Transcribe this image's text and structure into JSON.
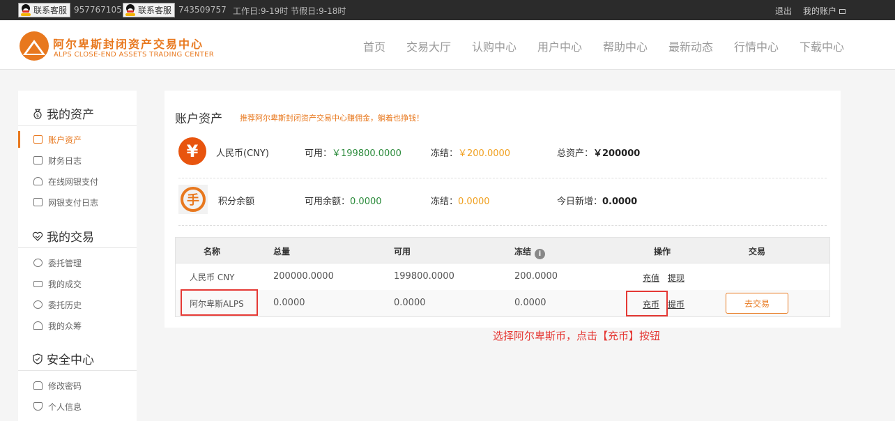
{
  "topbar": {
    "service_label": "联系客服",
    "qq1": "957767105",
    "qq2": "743509757",
    "hours": "工作日:9-19时 节假日:9-18时",
    "logout": "退出",
    "my_account": "我的账户"
  },
  "logo": {
    "cn": "阿尔卑斯封闭资产交易中心",
    "en": "ALPS CLOSE-END ASSETS TRADING CENTER"
  },
  "nav": [
    "首页",
    "交易大厅",
    "认购中心",
    "用户中心",
    "帮助中心",
    "最新动态",
    "行情中心",
    "下载中心"
  ],
  "sidebar": {
    "sections": [
      {
        "title": "我的资产",
        "icon": "moneybag-icon",
        "items": [
          "账户资产",
          "财务日志",
          "在线网银支付",
          "网银支付日志"
        ]
      },
      {
        "title": "我的交易",
        "icon": "handshake-icon",
        "items": [
          "委托管理",
          "我的成交",
          "委托历史",
          "我的众筹"
        ]
      },
      {
        "title": "安全中心",
        "icon": "shield-icon",
        "items": [
          "修改密码",
          "个人信息"
        ]
      }
    ],
    "active_item": "账户资产"
  },
  "main": {
    "title": "账户资产",
    "promo": "推荐阿尔卑斯封闭资产交易中心赚佣金，躺着也挣钱！",
    "cny": {
      "icon": "yen-icon",
      "icon_glyph": "¥",
      "label": "人民币(CNY)",
      "available_label": "可用：",
      "available": "￥199800.0000",
      "frozen_label": "冻结：",
      "frozen": "￥200.0000",
      "total_label": "总资产：",
      "total": "￥200000"
    },
    "points": {
      "icon": "points-icon",
      "icon_glyph": "手",
      "label": "积分余额",
      "available_label": "可用余额：",
      "available": "0.0000",
      "frozen_label": "冻结：",
      "frozen": "0.0000",
      "today_label": "今日新增：",
      "today": "0.0000"
    },
    "table": {
      "headers": [
        "名称",
        "总量",
        "可用",
        "冻结",
        "操作",
        "交易"
      ],
      "rows": [
        {
          "name": "人民币 CNY",
          "total": "200000.0000",
          "available": "199800.0000",
          "frozen": "200.0000",
          "deposit": "充值",
          "withdraw": "提现",
          "trade": ""
        },
        {
          "name": "阿尔卑斯ALPS",
          "total": "0.0000",
          "available": "0.0000",
          "frozen": "0.0000",
          "deposit": "充币",
          "withdraw": "提币",
          "trade": "去交易"
        }
      ]
    }
  },
  "instruction": "选择阿尔卑斯币，点击【充币】按钮",
  "colors": {
    "accent": "#e8781e",
    "highlight": "#e53935",
    "green": "#2a8a3a"
  }
}
